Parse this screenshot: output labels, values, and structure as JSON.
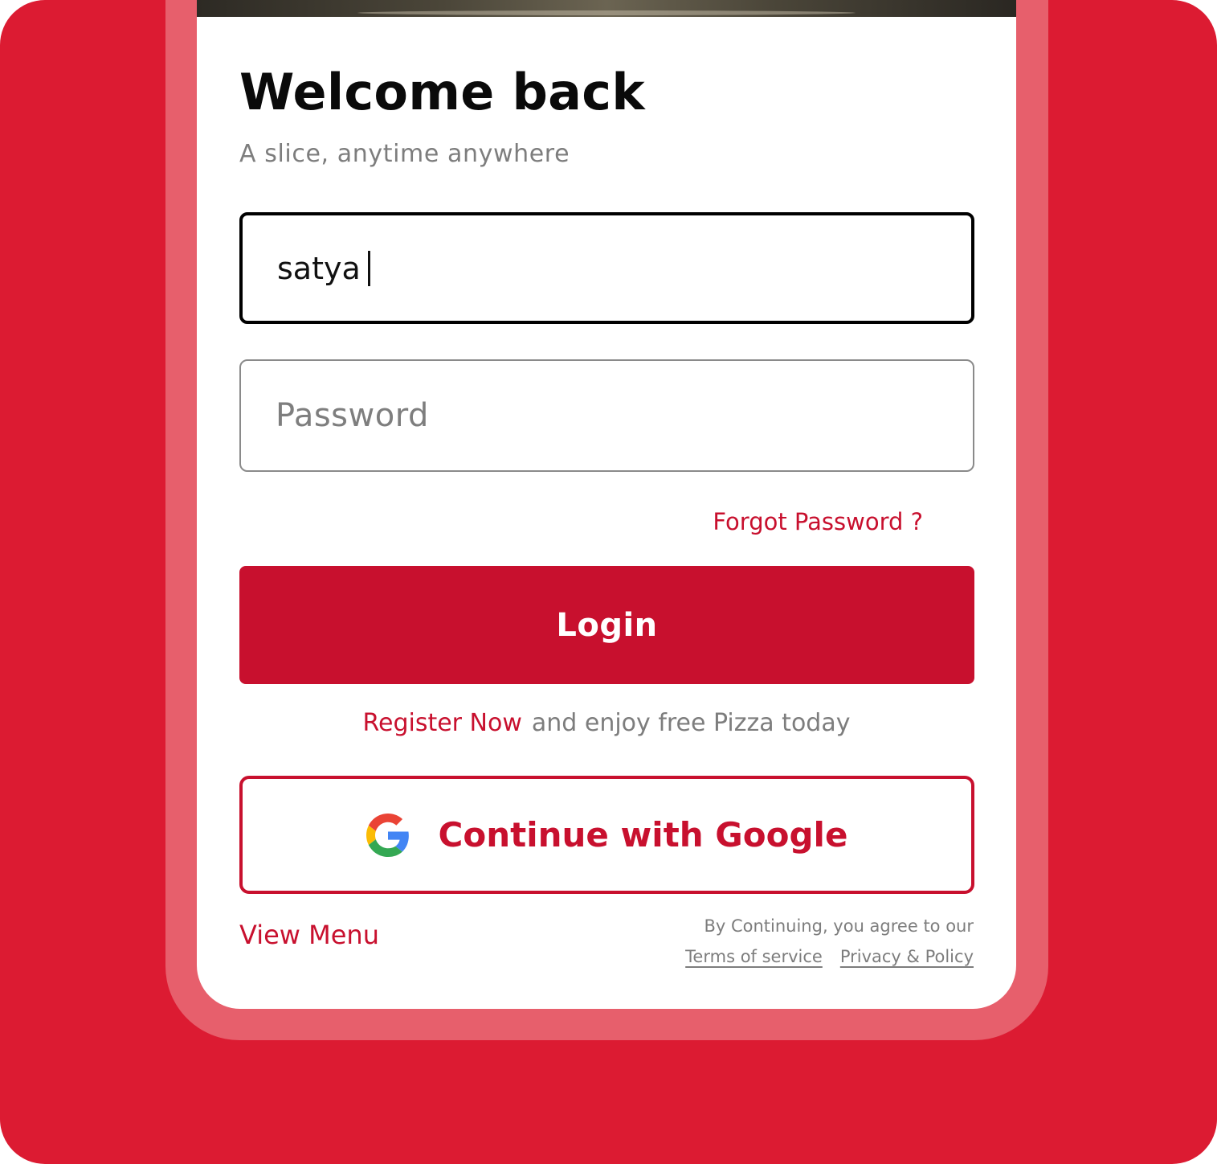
{
  "login": {
    "title": "Welcome back",
    "subtitle": "A slice, anytime anywhere",
    "username": {
      "value": "satya"
    },
    "password": {
      "placeholder": "Password"
    },
    "forgot_password": "Forgot Password ?",
    "login_button": "Login",
    "register": {
      "link": "Register Now",
      "text": "and enjoy free Pizza today"
    },
    "google_button": "Continue with Google",
    "view_menu": "View Menu",
    "legal": {
      "notice": "By Continuing, you agree to our",
      "terms": "Terms of service",
      "privacy": "Privacy & Policy"
    }
  },
  "colors": {
    "background": "#dc1b32",
    "frame": "#e75f6c",
    "accent": "#c8102e",
    "muted_text": "#7d7d7d"
  },
  "icons": {
    "google": "google-icon"
  }
}
